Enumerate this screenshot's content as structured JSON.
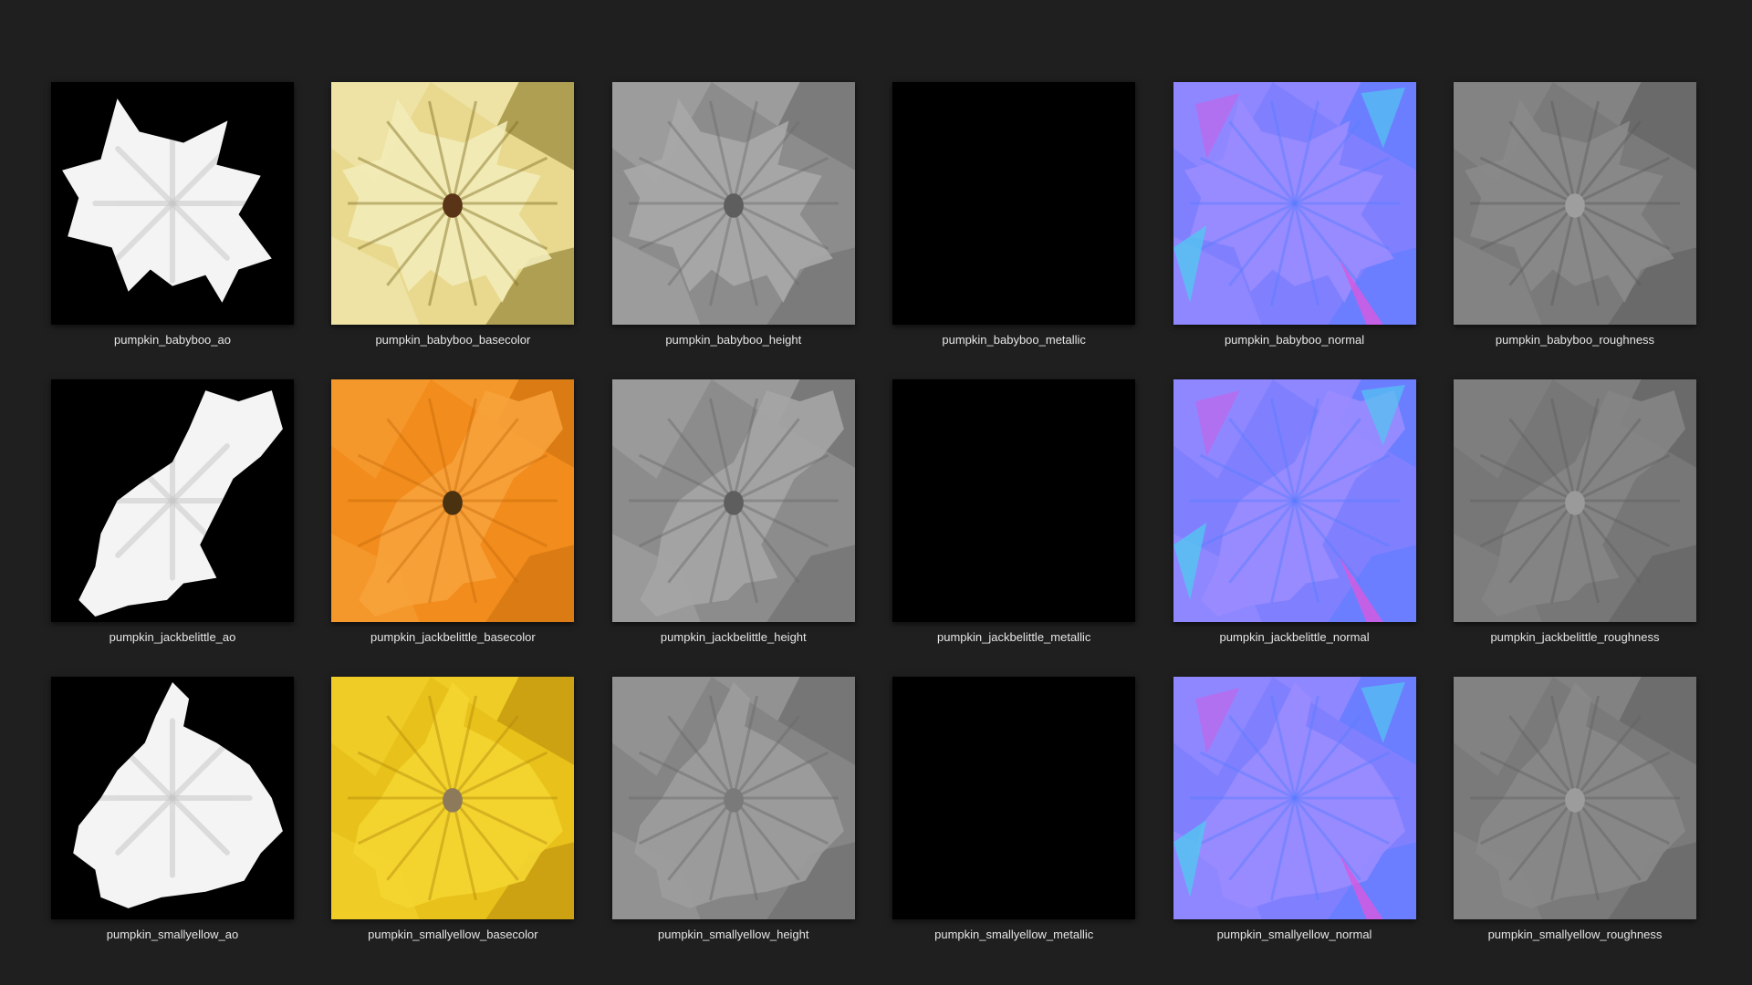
{
  "rows": [
    {
      "name": "pumpkin_babyboo",
      "items": [
        {
          "label": "pumpkin_babyboo_ao",
          "map": "ao",
          "colors": {
            "bg": "#000000",
            "fg": "#f4f4f4",
            "shade": "#c8c8c8"
          }
        },
        {
          "label": "pumpkin_babyboo_basecolor",
          "map": "basecolor",
          "colors": {
            "bg": "#e8d98f",
            "fg": "#f3ebb8",
            "shade": "#7f6f22",
            "center": "#5a3416"
          }
        },
        {
          "label": "pumpkin_babyboo_height",
          "map": "height",
          "colors": {
            "bg": "#8c8c8c",
            "fg": "#a9a9a9",
            "shade": "#6d6d6d",
            "center": "#5e5e5e"
          }
        },
        {
          "label": "pumpkin_babyboo_metallic",
          "map": "metallic",
          "colors": {
            "bg": "#000000"
          }
        },
        {
          "label": "pumpkin_babyboo_normal",
          "map": "normal",
          "colors": {
            "bg": "#8080ff",
            "fg": "#9a8cff",
            "shade": "#5a7cff",
            "accent": "#d45ae0",
            "accent2": "#53c6f0"
          }
        },
        {
          "label": "pumpkin_babyboo_roughness",
          "map": "roughness",
          "colors": {
            "bg": "#7a7a7a",
            "fg": "#8a8a8a",
            "shade": "#5c5c5c",
            "center": "#9e9e9e"
          }
        }
      ]
    },
    {
      "name": "pumpkin_jackbelittle",
      "items": [
        {
          "label": "pumpkin_jackbelittle_ao",
          "map": "ao",
          "colors": {
            "bg": "#000000",
            "fg": "#f4f4f4",
            "shade": "#c8c8c8"
          }
        },
        {
          "label": "pumpkin_jackbelittle_basecolor",
          "map": "basecolor",
          "colors": {
            "bg": "#f28c1c",
            "fg": "#f7a23b",
            "shade": "#c96d0e",
            "center": "#4a3210"
          }
        },
        {
          "label": "pumpkin_jackbelittle_height",
          "map": "height",
          "colors": {
            "bg": "#8c8c8c",
            "fg": "#a5a5a5",
            "shade": "#6a6a6a",
            "center": "#5e5e5e"
          }
        },
        {
          "label": "pumpkin_jackbelittle_metallic",
          "map": "metallic",
          "colors": {
            "bg": "#000000"
          }
        },
        {
          "label": "pumpkin_jackbelittle_normal",
          "map": "normal",
          "colors": {
            "bg": "#8080ff",
            "fg": "#9a8cff",
            "shade": "#5a7cff",
            "accent": "#d45ae0",
            "accent2": "#53c6f0"
          }
        },
        {
          "label": "pumpkin_jackbelittle_roughness",
          "map": "roughness",
          "colors": {
            "bg": "#777777",
            "fg": "#858585",
            "shade": "#606060",
            "center": "#9a9a9a"
          }
        }
      ]
    },
    {
      "name": "pumpkin_smallyellow",
      "items": [
        {
          "label": "pumpkin_smallyellow_ao",
          "map": "ao",
          "colors": {
            "bg": "#000000",
            "fg": "#f4f4f4",
            "shade": "#c8c8c8"
          }
        },
        {
          "label": "pumpkin_smallyellow_basecolor",
          "map": "basecolor",
          "colors": {
            "bg": "#e8c21a",
            "fg": "#f4d631",
            "shade": "#b4890d",
            "center": "#8c7a5a"
          }
        },
        {
          "label": "pumpkin_smallyellow_height",
          "map": "height",
          "colors": {
            "bg": "#858585",
            "fg": "#9d9d9d",
            "shade": "#6a6a6a",
            "center": "#7a7a7a"
          }
        },
        {
          "label": "pumpkin_smallyellow_metallic",
          "map": "metallic",
          "colors": {
            "bg": "#000000"
          }
        },
        {
          "label": "pumpkin_smallyellow_normal",
          "map": "normal",
          "colors": {
            "bg": "#8080ff",
            "fg": "#9a8cff",
            "shade": "#5a7cff",
            "accent": "#d45ae0",
            "accent2": "#53c6f0"
          }
        },
        {
          "label": "pumpkin_smallyellow_roughness",
          "map": "roughness",
          "colors": {
            "bg": "#7a7a7a",
            "fg": "#888888",
            "shade": "#626262",
            "center": "#9c9c9c"
          }
        }
      ]
    }
  ]
}
